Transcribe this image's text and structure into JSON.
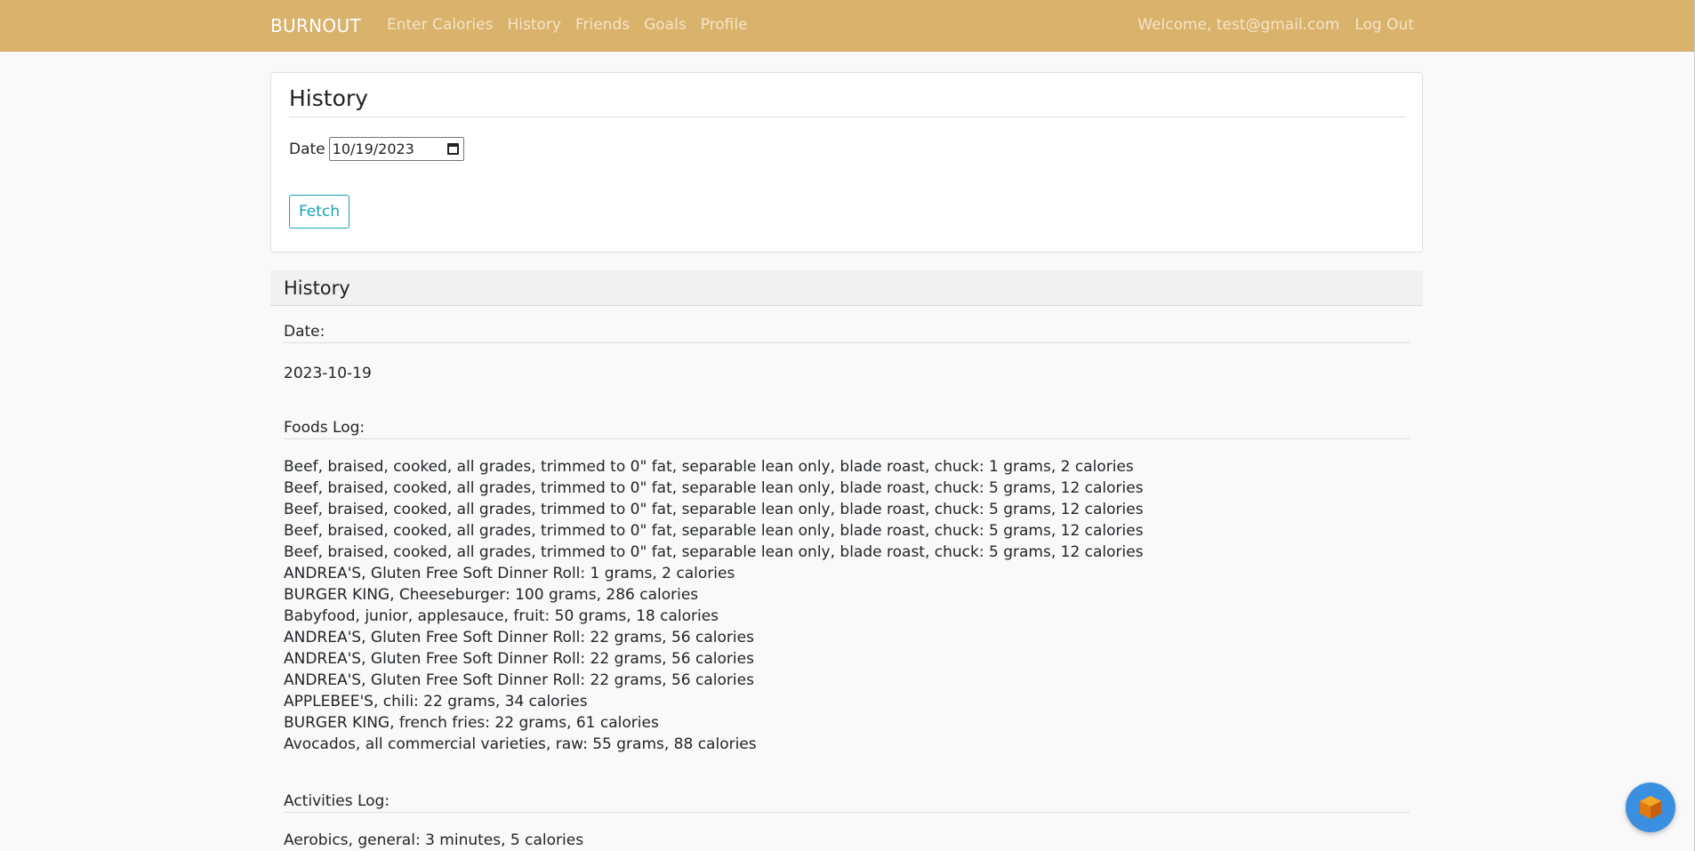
{
  "navbar": {
    "brand": "BURNOUT",
    "links": [
      "Enter Calories",
      "History",
      "Friends",
      "Goals",
      "Profile"
    ],
    "welcome": "Welcome, test@gmail.com",
    "logout": "Log Out",
    "bg_color": "#d9b26c"
  },
  "search_card": {
    "title": "History",
    "date_label": "Date",
    "date_value": "10/19/2023",
    "fetch_label": "Fetch"
  },
  "results": {
    "header": "History",
    "date_label": "Date:",
    "date_value": "2023-10-19",
    "foods_label": "Foods Log:",
    "foods": [
      "Beef, braised, cooked, all grades, trimmed to 0\" fat, separable lean only, blade roast, chuck: 1 grams, 2 calories",
      "Beef, braised, cooked, all grades, trimmed to 0\" fat, separable lean only, blade roast, chuck: 5 grams, 12 calories",
      "Beef, braised, cooked, all grades, trimmed to 0\" fat, separable lean only, blade roast, chuck: 5 grams, 12 calories",
      "Beef, braised, cooked, all grades, trimmed to 0\" fat, separable lean only, blade roast, chuck: 5 grams, 12 calories",
      "Beef, braised, cooked, all grades, trimmed to 0\" fat, separable lean only, blade roast, chuck: 5 grams, 12 calories",
      "ANDREA'S, Gluten Free Soft Dinner Roll: 1 grams, 2 calories",
      "BURGER KING, Cheeseburger: 100 grams, 286 calories",
      "Babyfood, junior, applesauce, fruit: 50 grams, 18 calories",
      "ANDREA'S, Gluten Free Soft Dinner Roll: 22 grams, 56 calories",
      "ANDREA'S, Gluten Free Soft Dinner Roll: 22 grams, 56 calories",
      "ANDREA'S, Gluten Free Soft Dinner Roll: 22 grams, 56 calories",
      "APPLEBEE'S, chili: 22 grams, 34 calories",
      "BURGER KING, french fries: 22 grams, 61 calories",
      "Avocados, all commercial varieties, raw: 55 grams, 88 calories"
    ],
    "activities_label": "Activities Log:",
    "activities": [
      "Aerobics, general: 3 minutes, 5 calories"
    ]
  },
  "icons": {
    "calendar": "calendar-icon",
    "help": "cube-icon"
  }
}
